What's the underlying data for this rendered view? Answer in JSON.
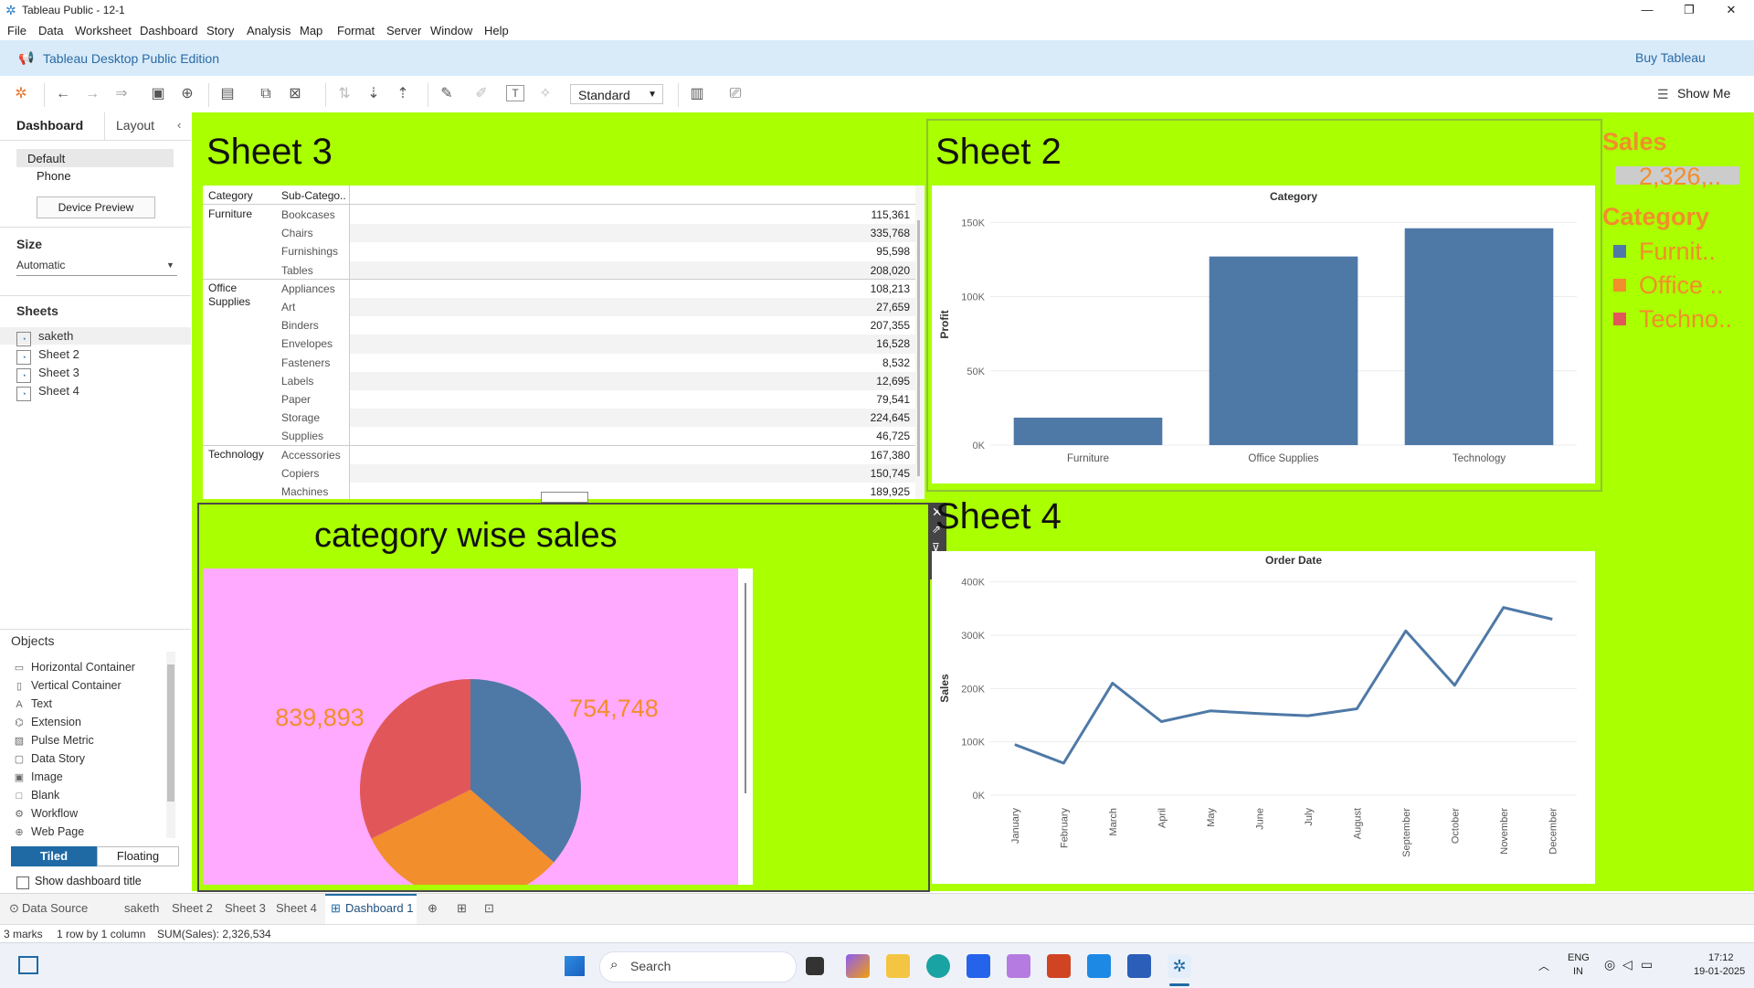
{
  "window": {
    "title": "Tableau Public - 12-1",
    "min": "—",
    "max": "❐",
    "close": "✕"
  },
  "menu": [
    "File",
    "Data",
    "Worksheet",
    "Dashboard",
    "Story",
    "Analysis",
    "Map",
    "Format",
    "Server",
    "Window",
    "Help"
  ],
  "public_bar": {
    "edition": "Tableau Desktop Public Edition",
    "buy": "Buy Tableau"
  },
  "toolbar": {
    "fit": "Standard",
    "show_me": "Show Me"
  },
  "left_pane": {
    "tabs": [
      "Dashboard",
      "Layout"
    ],
    "device": {
      "default": "Default",
      "phone": "Phone",
      "preview_button": "Device Preview"
    },
    "size": {
      "heading": "Size",
      "value": "Automatic"
    },
    "sheets": {
      "heading": "Sheets",
      "items": [
        "saketh",
        "Sheet 2",
        "Sheet 3",
        "Sheet 4"
      ]
    },
    "objects": {
      "heading": "Objects",
      "items": [
        "Horizontal Container",
        "Vertical Container",
        "Text",
        "Extension",
        "Pulse Metric",
        "Data Story",
        "Image",
        "Blank",
        "Workflow",
        "Web Page"
      ]
    },
    "tiled": "Tiled",
    "floating": "Floating",
    "show_title": "Show dashboard title"
  },
  "sheet3": {
    "title": "Sheet 3",
    "headers": [
      "Category",
      "Sub-Catego.."
    ],
    "groups": [
      {
        "category": "Furniture",
        "rows": [
          [
            "Bookcases",
            "115,361"
          ],
          [
            "Chairs",
            "335,768"
          ],
          [
            "Furnishings",
            "95,598"
          ],
          [
            "Tables",
            "208,020"
          ]
        ]
      },
      {
        "category": "Office Supplies",
        "rows": [
          [
            "Appliances",
            "108,213"
          ],
          [
            "Art",
            "27,659"
          ],
          [
            "Binders",
            "207,355"
          ],
          [
            "Envelopes",
            "16,528"
          ],
          [
            "Fasteners",
            "8,532"
          ],
          [
            "Labels",
            "12,695"
          ],
          [
            "Paper",
            "79,541"
          ],
          [
            "Storage",
            "224,645"
          ],
          [
            "Supplies",
            "46,725"
          ]
        ]
      },
      {
        "category": "Technology",
        "rows": [
          [
            "Accessories",
            "167,380"
          ],
          [
            "Copiers",
            "150,745"
          ],
          [
            "Machines",
            "189,925"
          ]
        ]
      }
    ]
  },
  "sheet2": {
    "title": "Sheet 2"
  },
  "sheet4": {
    "title": "Sheet 4"
  },
  "pie_title": "category wise sales",
  "legend": {
    "sales_title": "Sales",
    "sales_value": "2,326,..",
    "category_title": "Category",
    "items": [
      "Furnit..",
      "Office ..",
      "Techno.."
    ]
  },
  "colors": {
    "furniture": "#4e79a7",
    "office": "#f28e2b",
    "technology": "#e15759",
    "dashboard_bg": "#aaff00",
    "pie_bg": "#ffaaff",
    "legend_text": "#f28e2b"
  },
  "chart_data": [
    {
      "type": "bar",
      "title": "Category",
      "ylabel": "Profit",
      "categories": [
        "Furniture",
        "Office Supplies",
        "Technology"
      ],
      "values": [
        18500,
        127000,
        146000
      ],
      "ylim": [
        0,
        160000
      ],
      "yticks": [
        0,
        50000,
        100000,
        150000
      ],
      "ytick_labels": [
        "0K",
        "50K",
        "100K",
        "150K"
      ]
    },
    {
      "type": "line",
      "title": "Order Date",
      "ylabel": "Sales",
      "x": [
        "January",
        "February",
        "March",
        "April",
        "May",
        "June",
        "July",
        "August",
        "September",
        "October",
        "November",
        "December"
      ],
      "values": [
        95000,
        60000,
        210000,
        138000,
        158000,
        153000,
        149000,
        162000,
        308000,
        206000,
        352000,
        330000
      ],
      "ylim": [
        0,
        420000
      ],
      "yticks": [
        0,
        100000,
        200000,
        300000,
        400000
      ],
      "ytick_labels": [
        "0K",
        "100K",
        "200K",
        "300K",
        "400K"
      ]
    },
    {
      "type": "pie",
      "categories": [
        "Technology",
        "Office Supplies",
        "Furniture"
      ],
      "values": [
        836154,
        719047,
        741999
      ],
      "data_labels": [
        "754,748",
        "839,893"
      ]
    }
  ],
  "bottom_tabs": {
    "data_source": "Data Source",
    "tabs": [
      "saketh",
      "Sheet 2",
      "Sheet 3",
      "Sheet 4"
    ],
    "active": "Dashboard 1"
  },
  "status": {
    "marks": "3 marks",
    "rows": "1 row by 1 column",
    "sum": "SUM(Sales): 2,326,534"
  },
  "taskbar": {
    "search": "Search",
    "lang1": "ENG",
    "lang2": "IN",
    "time": "17:12",
    "date": "19-01-2025"
  }
}
